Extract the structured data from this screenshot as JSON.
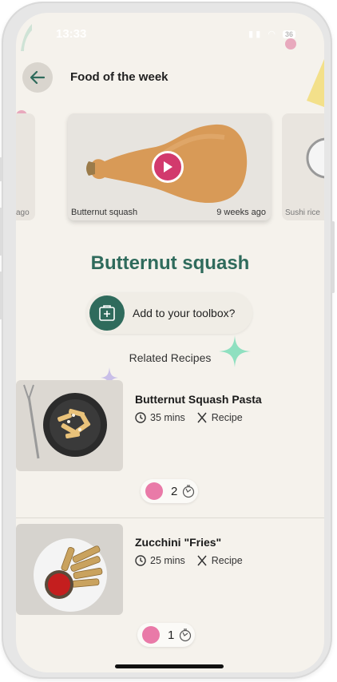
{
  "status_bar": {
    "time": "13:33",
    "battery": "36"
  },
  "header": {
    "title": "Food of the week"
  },
  "carousel": {
    "left_card": {
      "age": "ago"
    },
    "main_card": {
      "name": "Butternut squash",
      "age": "9 weeks ago"
    },
    "right_card": {
      "name": "Sushi rice"
    }
  },
  "food": {
    "title": "Butternut squash"
  },
  "toolbox": {
    "label": "Add to your toolbox?"
  },
  "related": {
    "heading": "Related Recipes"
  },
  "recipes": [
    {
      "title": "Butternut Squash Pasta",
      "time": "35 mins",
      "type": "Recipe",
      "rating_count": "2"
    },
    {
      "title": "Zucchini \"Fries\"",
      "time": "25 mins",
      "type": "Recipe",
      "rating_count": "1"
    }
  ],
  "colors": {
    "accent": "#2f6b5c",
    "play": "#d23a6d",
    "background": "#f5f2ec",
    "rating_face": "#e97aa8"
  },
  "icons": [
    "back-arrow-icon",
    "play-icon",
    "add-to-toolbox-icon",
    "clock-icon",
    "cutlery-icon",
    "smiley-icon",
    "timer-icon",
    "sparkle-icon"
  ]
}
